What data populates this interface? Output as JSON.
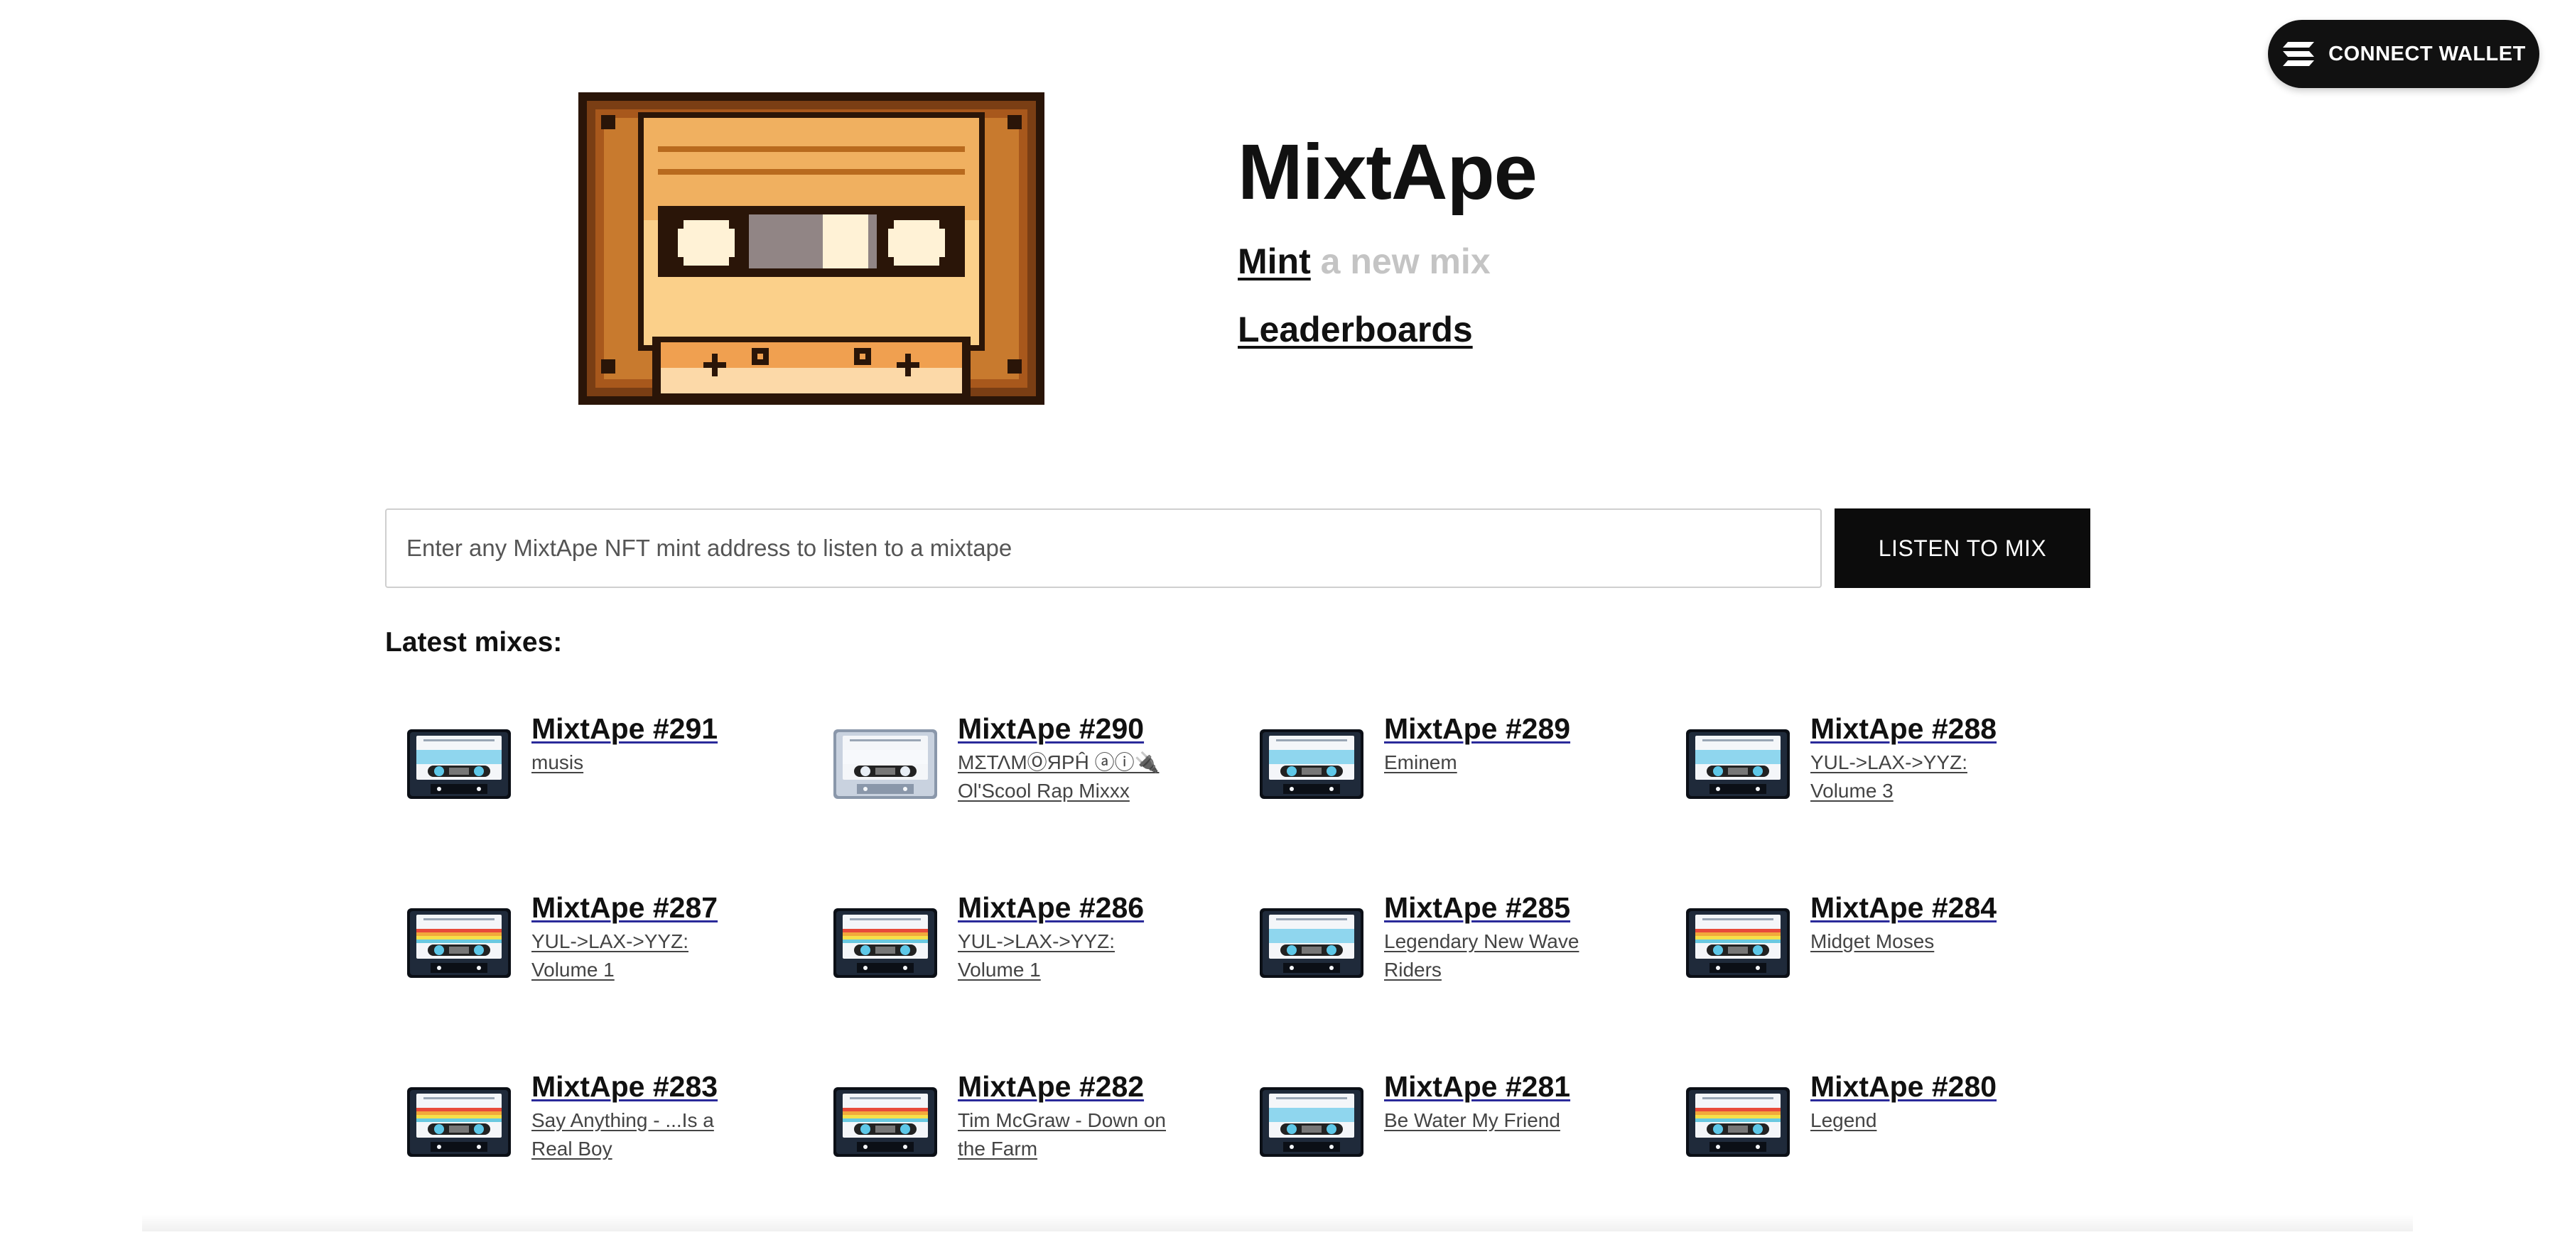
{
  "header": {
    "connect_wallet_label": "CONNECT WALLET",
    "wallet_icon": "solana-logo-icon"
  },
  "hero": {
    "logo_icon": "pixel-cassette-logo",
    "title": "MixtApe",
    "mint_link": "Mint",
    "mint_suffix": "a new mix",
    "leaderboards_link": "Leaderboards"
  },
  "search": {
    "placeholder": "Enter any MixtApe NFT mint address to listen to a mixtape",
    "value": "",
    "button_label": "LISTEN TO MIX"
  },
  "latest": {
    "heading": "Latest mixes:",
    "items": [
      {
        "title": "MixtApe #291",
        "subtitle": "musis",
        "style": "dark"
      },
      {
        "title": "MixtApe #290",
        "subtitle": "ΜΣΤΛΜⓄЯΡĤ ⓐⓘ🔌 Ol'Scool Rap Mixxx",
        "style": "light"
      },
      {
        "title": "MixtApe #289",
        "subtitle": "Eminem",
        "style": "dark"
      },
      {
        "title": "MixtApe #288",
        "subtitle": "YUL->LAX->YYZ: Volume 3",
        "style": "dark"
      },
      {
        "title": "MixtApe #287",
        "subtitle": "YUL->LAX->YYZ: Volume 1",
        "style": "stripe"
      },
      {
        "title": "MixtApe #286",
        "subtitle": "YUL->LAX->YYZ: Volume 1",
        "style": "stripe"
      },
      {
        "title": "MixtApe #285",
        "subtitle": "Legendary New Wave Riders",
        "style": "dark"
      },
      {
        "title": "MixtApe #284",
        "subtitle": "Midget Moses",
        "style": "stripe"
      },
      {
        "title": "MixtApe #283",
        "subtitle": "Say Anything - ...Is a Real Boy",
        "style": "stripe"
      },
      {
        "title": "MixtApe #282",
        "subtitle": "Tim McGraw - Down on the Farm",
        "style": "stripe"
      },
      {
        "title": "MixtApe #281",
        "subtitle": "Be Water My Friend",
        "style": "dark"
      },
      {
        "title": "MixtApe #280",
        "subtitle": "Legend",
        "style": "stripe"
      }
    ]
  },
  "colors": {
    "primary": "#111111",
    "muted_text": "#c4c4c4",
    "cassette_body": "#1f2a3a",
    "cassette_accent": "#5ec8e8"
  }
}
